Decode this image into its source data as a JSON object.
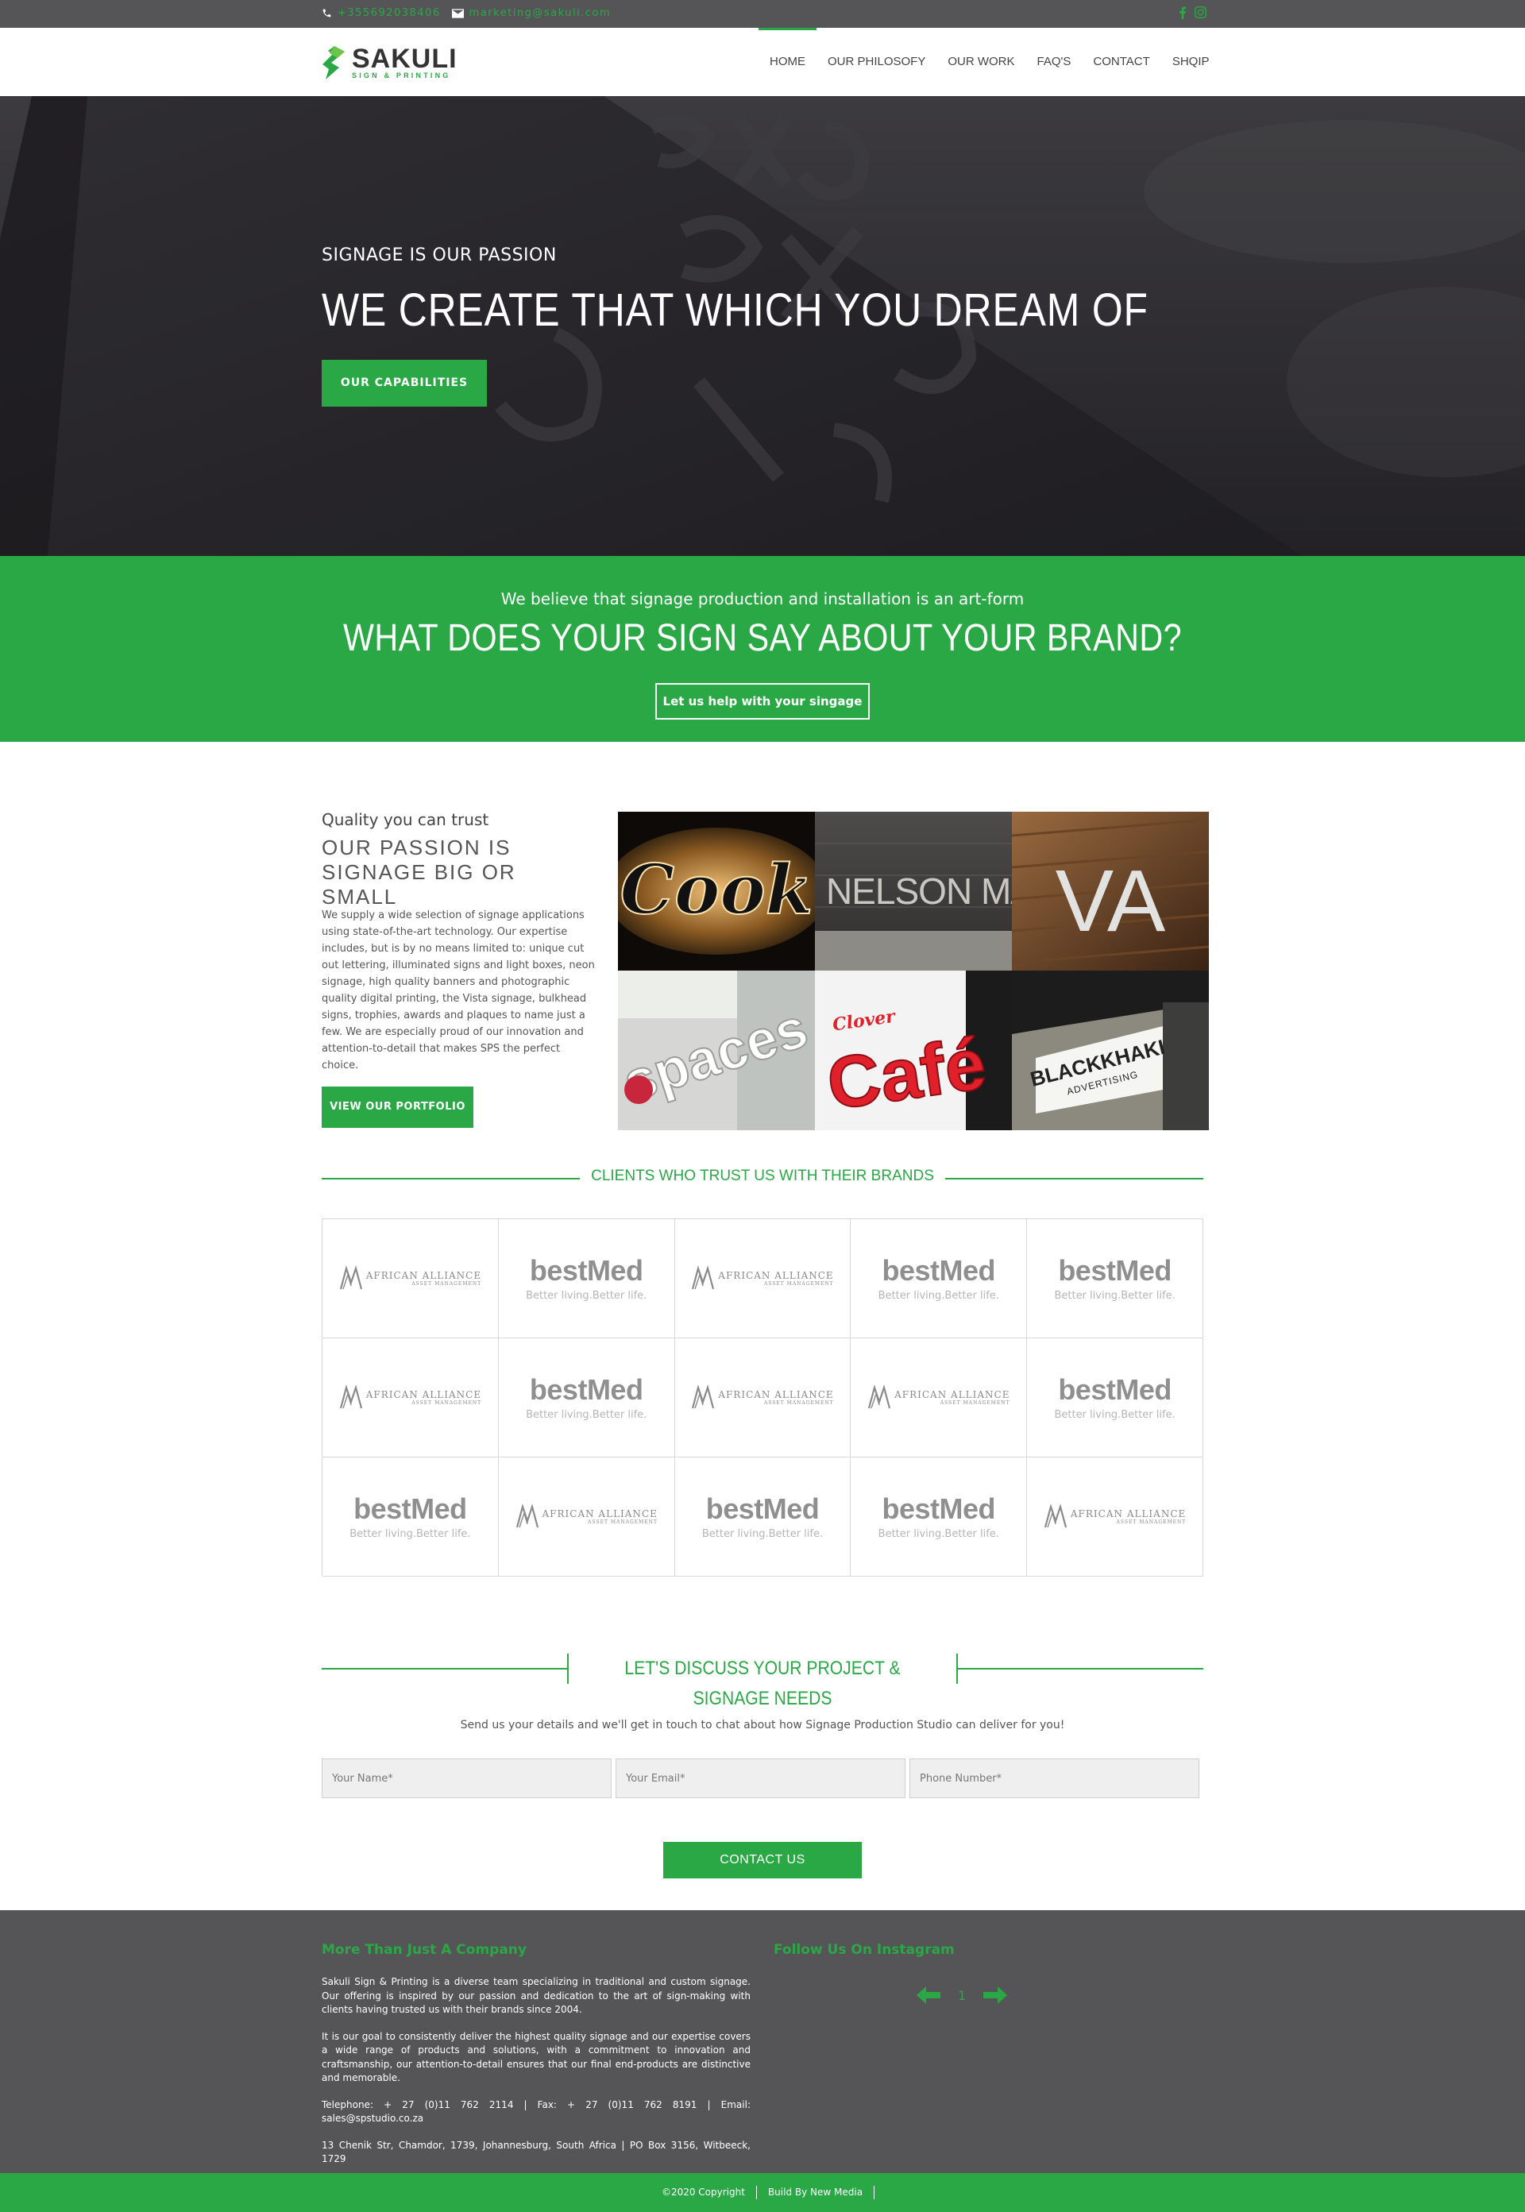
{
  "topbar": {
    "phone": "+355692038406",
    "email": "marketing@sakuli.com",
    "social": [
      "facebook-icon",
      "instagram-icon"
    ]
  },
  "brand": {
    "name": "SAKULI",
    "tagline": "SIGN & PRINTING",
    "accent": "#2aa845"
  },
  "nav": {
    "items": [
      {
        "label": "HOME",
        "active": true
      },
      {
        "label": "OUR PHILOSOFY",
        "active": false
      },
      {
        "label": "OUR WORK",
        "active": false
      },
      {
        "label": "FAQ'S",
        "active": false
      },
      {
        "label": "CONTACT",
        "active": false
      },
      {
        "label": "SHQIP",
        "active": false
      }
    ]
  },
  "hero": {
    "kicker": "SIGNAGE IS OUR PASSION",
    "headline": "WE CREATE THAT WHICH YOU DREAM OF",
    "button": "OUR CAPABILITIES"
  },
  "band": {
    "sub": "We believe that signage production and installation is an art-form",
    "title": "WHAT DOES YOUR SIGN SAY ABOUT YOUR BRAND?",
    "button": "Let us help with your singage"
  },
  "passion": {
    "kicker": "Quality you can trust",
    "heading": "OUR PASSION IS SIGNAGE BIG OR SMALL",
    "body": "We supply a wide selection of signage applications using state-of-the-art technology. Our expertise includes, but is by no means limited to: unique cut out lettering, illuminated signs and light boxes, neon signage, high quality banners and photographic quality digital printing, the Vista signage, bulkhead signs, trophies, awards and plaques to name just a few. We are especially proud of our innovation and attention-to-detail that makes SPS the perfect choice.",
    "button": "VIEW OUR PORTFOLIO",
    "gallery": [
      {
        "label": "Cook"
      },
      {
        "label": "NELSON MANDELA"
      },
      {
        "label": "VA"
      },
      {
        "label": "spaces"
      },
      {
        "label": "Clover",
        "label2": "Café"
      },
      {
        "label": "BLACKKHAKI",
        "label2": "ADVERTISING"
      }
    ]
  },
  "clients": {
    "title": "CLIENTS WHO TRUST US WITH THEIR BRANDS",
    "aa_name": "AFRICAN ALLIANCE",
    "aa_sub": "ASSET MANAGEMENT",
    "bm_name": "bestMed",
    "bm_tag": "Better living.Better life.",
    "grid": [
      "aa",
      "bm",
      "aa",
      "bm",
      "bm",
      "aa",
      "bm",
      "aa",
      "aa",
      "bm",
      "bm",
      "aa",
      "bm",
      "bm",
      "aa"
    ]
  },
  "discuss": {
    "title": "LET'S DISCUSS YOUR PROJECT & SIGNAGE NEEDS",
    "sub": "Send us your details and we'll get in touch to chat about how Signage Production Studio can deliver for you!",
    "name_placeholder": "Your Name*",
    "email_placeholder": "Your Email*",
    "phone_placeholder": "Phone Number*",
    "button": "CONTACT US"
  },
  "footer": {
    "col1_title": "More Than Just A Company",
    "p1": "Sakuli Sign & Printing is a diverse team specializing in traditional and custom signage. Our offering is inspired by our passion and dedication to the art of sign-making with clients having trusted us with their brands since 2004.",
    "p2": "It is our goal to consistently deliver the highest quality signage and our expertise covers a wide range of products and solutions, with a commitment to innovation and craftsmanship, our attention-to-detail ensures that our final end-products are distinctive and memorable.",
    "contact": "Telephone: + 27 (0)11 762 2114 | Fax: + 27 (0)11 762 8191 | Email: sales@spstudio.co.za",
    "address": "13 Chenik Str, Chamdor, 1739, Johannesburg, South Africa | PO Box 3156, Witbeeck, 1729",
    "col2_title": "Follow Us On Instagram",
    "page": "1"
  },
  "copyright": {
    "text": "©2020 Copyright",
    "credit": "Build By New Media"
  }
}
